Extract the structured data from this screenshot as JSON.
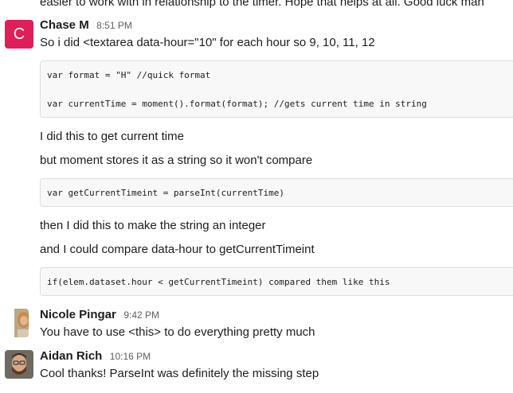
{
  "previous_message_tail": "easier to work with in relationship to the timer. Hope that helps at all. Good luck man",
  "messages": [
    {
      "author": "Chase M",
      "avatar_letter": "C",
      "time": "8:51 PM",
      "text": "So i did <textarea data-hour=\"10\" for each hour so 9, 10, 11, 12",
      "code1": [
        "var format = \"H\" //quick format",
        "var currentTime = moment().format(format); //gets current time in string"
      ],
      "text2": "I did this to get current time",
      "text3": "but moment stores it as a string so it won't compare",
      "code2": "var getCurrentTimeint = parseInt(currentTime)",
      "text4": "then I did this to make the string an integer",
      "text5": "and I could compare data-hour to getCurrentTimeint",
      "code3": "if(elem.dataset.hour < getCurrentTimeint) compared them like this"
    },
    {
      "author": "Nicole Pingar",
      "time": "9:42 PM",
      "text": "You have to use <this> to do everything pretty much"
    },
    {
      "author": "Aidan Rich",
      "time": "10:16 PM",
      "text": "Cool thanks! ParseInt was definitely the missing step"
    }
  ],
  "colors": {
    "avatar_c": "#e01e5a",
    "code_bg": "#f8f8f8"
  }
}
